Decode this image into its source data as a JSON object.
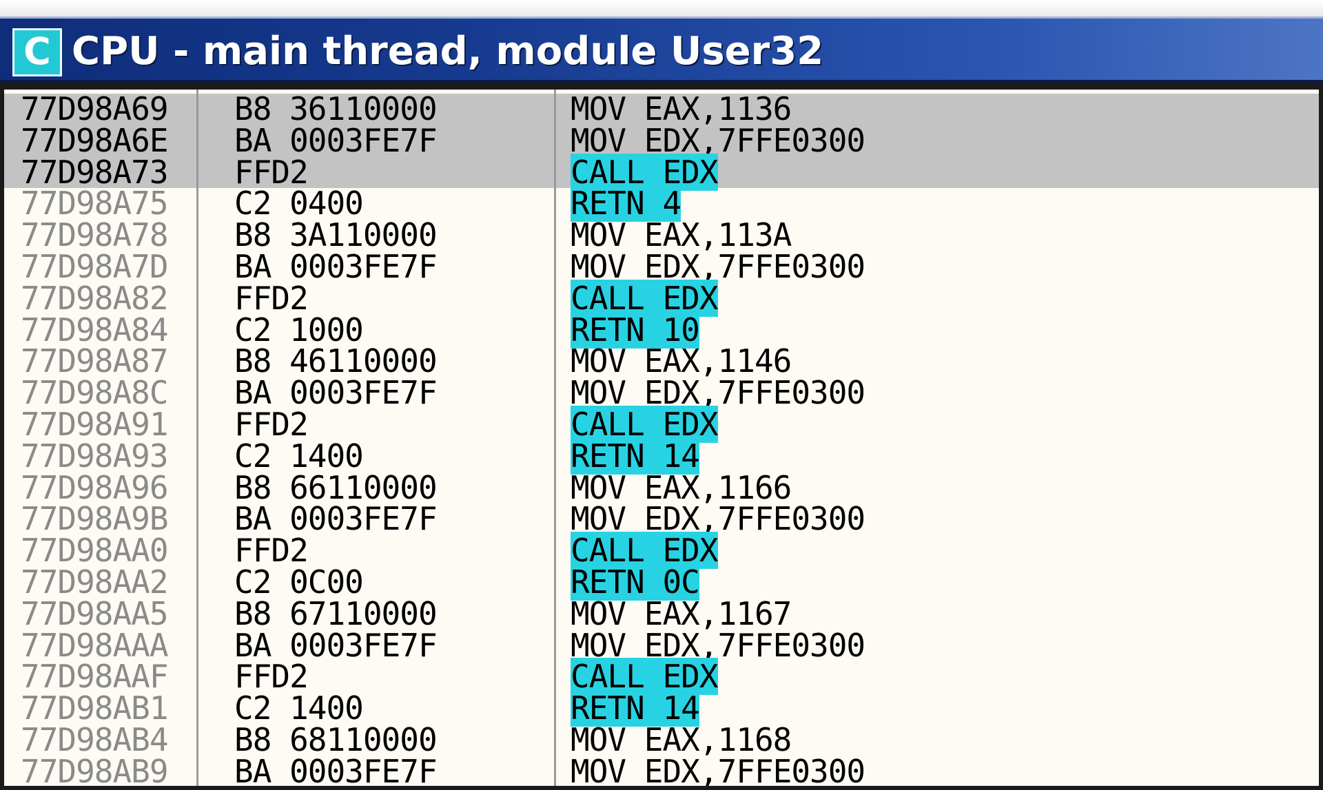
{
  "window": {
    "icon_letter": "C",
    "title": "CPU - main thread, module User32"
  },
  "colors": {
    "titlebar": "#163a8f",
    "icon": "#22c9d4",
    "highlight": "#27d3e3",
    "selected_row": "#c3c3c3",
    "background": "#fdfbf3",
    "address_dim": "#8a8a8a"
  },
  "disassembly": [
    {
      "address": "77D98A69",
      "hex": "B8 36110000",
      "instr": "MOV EAX,1136",
      "selected": true,
      "highlight": false
    },
    {
      "address": "77D98A6E",
      "hex": "BA 0003FE7F",
      "instr": "MOV EDX,7FFE0300",
      "selected": true,
      "highlight": false
    },
    {
      "address": "77D98A73",
      "hex": "FFD2",
      "instr": "CALL EDX",
      "selected": true,
      "highlight": true
    },
    {
      "address": "77D98A75",
      "hex": "C2 0400",
      "instr": "RETN 4",
      "selected": false,
      "highlight": true
    },
    {
      "address": "77D98A78",
      "hex": "B8 3A110000",
      "instr": "MOV EAX,113A",
      "selected": false,
      "highlight": false
    },
    {
      "address": "77D98A7D",
      "hex": "BA 0003FE7F",
      "instr": "MOV EDX,7FFE0300",
      "selected": false,
      "highlight": false
    },
    {
      "address": "77D98A82",
      "hex": "FFD2",
      "instr": "CALL EDX",
      "selected": false,
      "highlight": true
    },
    {
      "address": "77D98A84",
      "hex": "C2 1000",
      "instr": "RETN 10",
      "selected": false,
      "highlight": true
    },
    {
      "address": "77D98A87",
      "hex": "B8 46110000",
      "instr": "MOV EAX,1146",
      "selected": false,
      "highlight": false
    },
    {
      "address": "77D98A8C",
      "hex": "BA 0003FE7F",
      "instr": "MOV EDX,7FFE0300",
      "selected": false,
      "highlight": false
    },
    {
      "address": "77D98A91",
      "hex": "FFD2",
      "instr": "CALL EDX",
      "selected": false,
      "highlight": true
    },
    {
      "address": "77D98A93",
      "hex": "C2 1400",
      "instr": "RETN 14",
      "selected": false,
      "highlight": true
    },
    {
      "address": "77D98A96",
      "hex": "B8 66110000",
      "instr": "MOV EAX,1166",
      "selected": false,
      "highlight": false
    },
    {
      "address": "77D98A9B",
      "hex": "BA 0003FE7F",
      "instr": "MOV EDX,7FFE0300",
      "selected": false,
      "highlight": false
    },
    {
      "address": "77D98AA0",
      "hex": "FFD2",
      "instr": "CALL EDX",
      "selected": false,
      "highlight": true
    },
    {
      "address": "77D98AA2",
      "hex": "C2 0C00",
      "instr": "RETN 0C",
      "selected": false,
      "highlight": true
    },
    {
      "address": "77D98AA5",
      "hex": "B8 67110000",
      "instr": "MOV EAX,1167",
      "selected": false,
      "highlight": false
    },
    {
      "address": "77D98AAA",
      "hex": "BA 0003FE7F",
      "instr": "MOV EDX,7FFE0300",
      "selected": false,
      "highlight": false
    },
    {
      "address": "77D98AAF",
      "hex": "FFD2",
      "instr": "CALL EDX",
      "selected": false,
      "highlight": true
    },
    {
      "address": "77D98AB1",
      "hex": "C2 1400",
      "instr": "RETN 14",
      "selected": false,
      "highlight": true
    },
    {
      "address": "77D98AB4",
      "hex": "B8 68110000",
      "instr": "MOV EAX,1168",
      "selected": false,
      "highlight": false
    },
    {
      "address": "77D98AB9",
      "hex": "BA 0003FE7F",
      "instr": "MOV EDX,7FFE0300",
      "selected": false,
      "highlight": false
    }
  ]
}
